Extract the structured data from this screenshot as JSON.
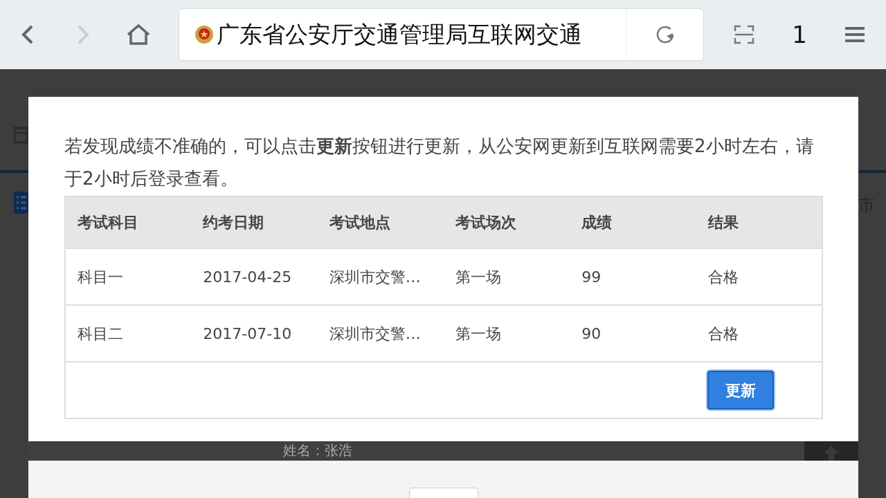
{
  "browser": {
    "address": "广东省公安厅交通管理局互联网交通",
    "tab_count": "1"
  },
  "background": {
    "side_text": "市",
    "name_text": "姓名：张浩"
  },
  "modal": {
    "notice": "若发现成绩不准确的，可以点击**更新**按钮进行更新，从公安网更新到互联网需要2小时左右，请于2小时后登录查看。",
    "table": {
      "columns": [
        "考试科目",
        "约考日期",
        "考试地点",
        "考试场次",
        "成绩",
        "结果"
      ],
      "rows": [
        [
          "科目一",
          "2017-04-25",
          "深圳市交警…",
          "第一场",
          "99",
          "合格"
        ],
        [
          "科目二",
          "2017-07-10",
          "深圳市交警…",
          "第一场",
          "90",
          "合格"
        ]
      ]
    },
    "update_button": "更新"
  }
}
